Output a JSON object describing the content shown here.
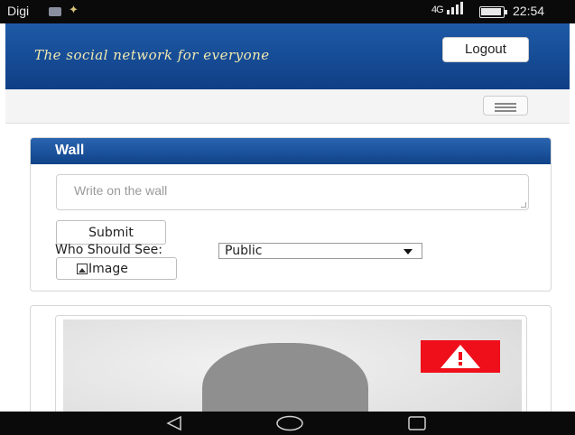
{
  "statusbar": {
    "carrier": "Digi",
    "network": "4G",
    "time": "22:54",
    "icons": [
      "thumbnail-icon",
      "notification-icon",
      "signal-icon",
      "battery-icon"
    ]
  },
  "header": {
    "tagline": "The social network for everyone",
    "logout_label": "Logout"
  },
  "navbar": {
    "menu_icon": "hamburger-icon"
  },
  "wall": {
    "title": "Wall",
    "placeholder": "Write on the wall",
    "submit_label": "Submit",
    "who_label": "Who Should See:",
    "who_value": "Public",
    "image_label": "Image"
  },
  "post": {
    "image_icon": "profile-silhouette-icon",
    "warning_icon": "warning-icon"
  },
  "android_nav": {
    "buttons": [
      "back-icon",
      "home-icon",
      "recents-icon"
    ]
  },
  "colors": {
    "header_blue": "#1e5aa7",
    "panel_blue": "#0f4389",
    "tagline": "#f0e9b0",
    "warning_red": "#ef0f1b"
  }
}
